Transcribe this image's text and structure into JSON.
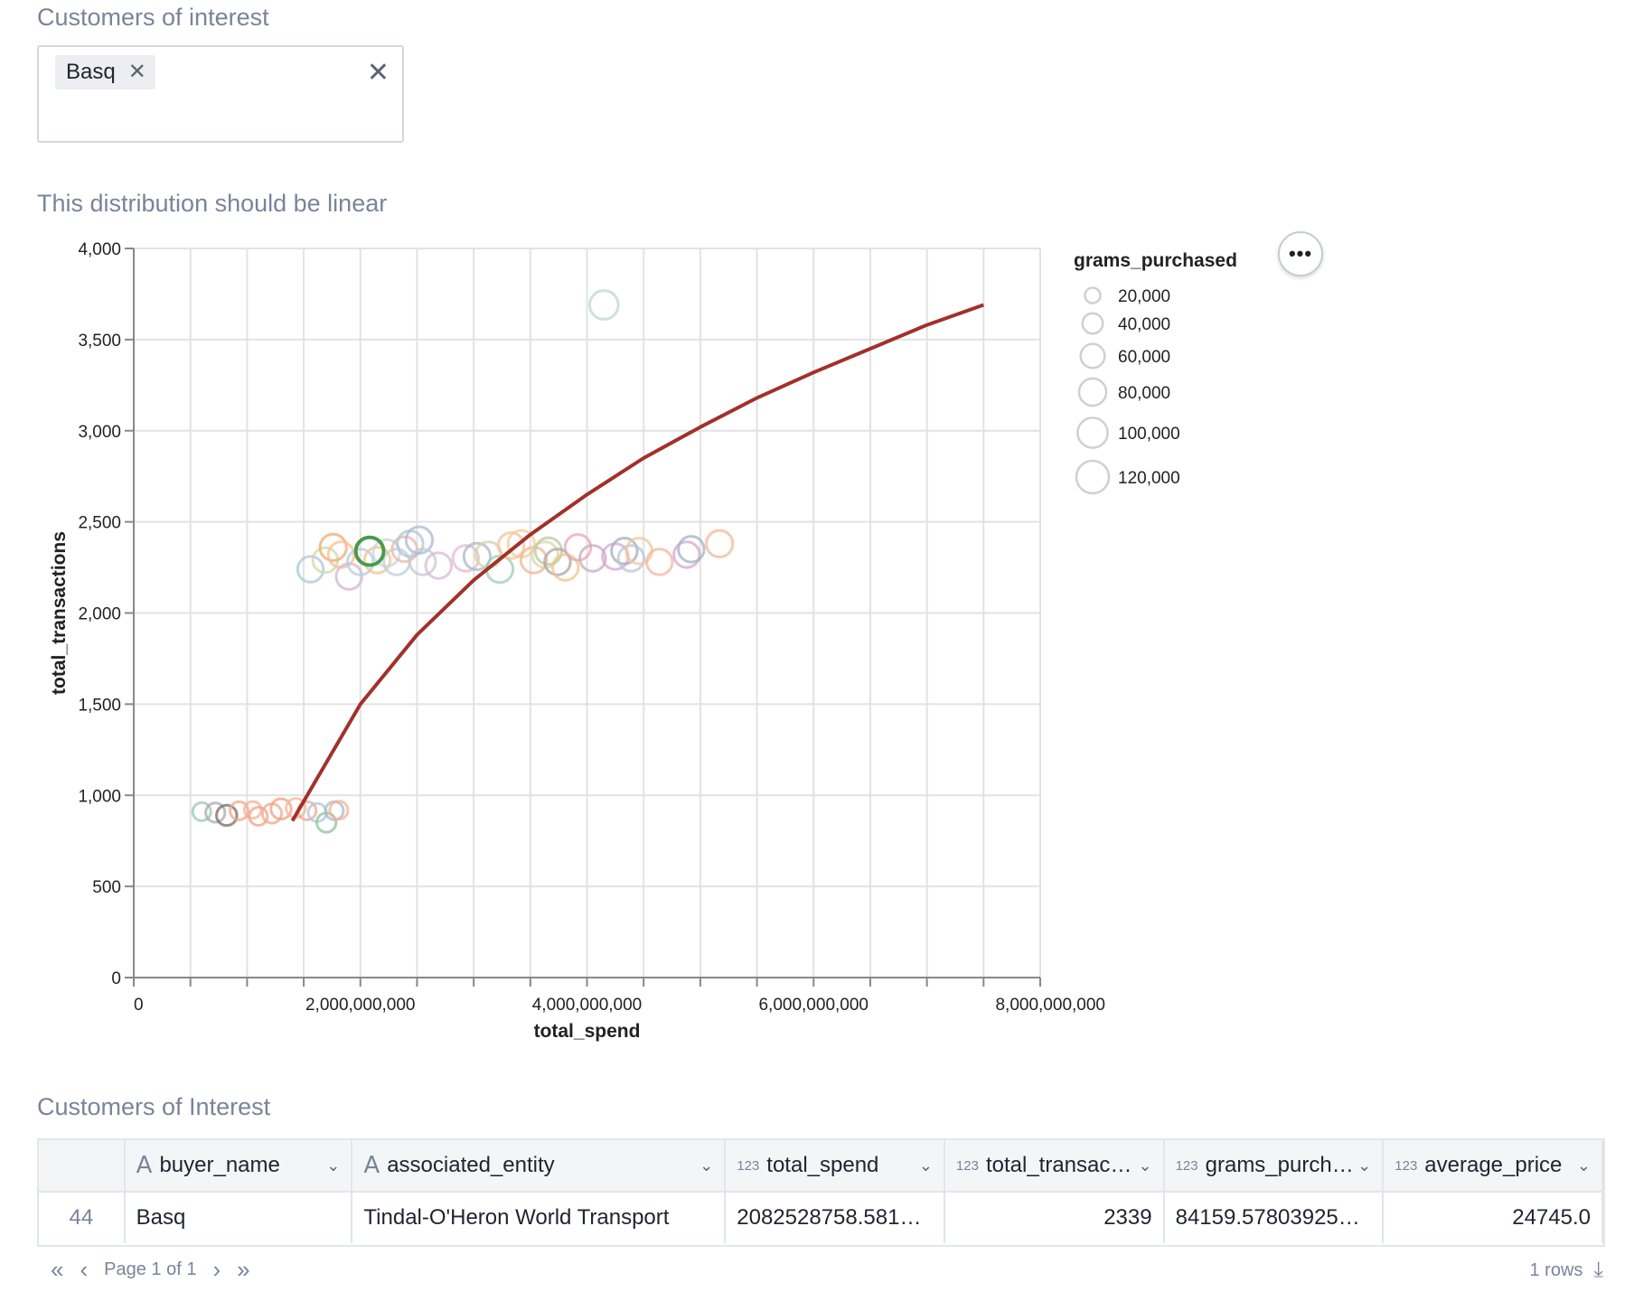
{
  "filter": {
    "title": "Customers of interest",
    "chips": [
      "Basq"
    ],
    "chip_remove_glyph": "✕",
    "clear_glyph": "✕"
  },
  "chart_section": {
    "title": "This distribution should be linear",
    "more_glyph": "•••"
  },
  "chart_data": {
    "type": "scatter",
    "title": "This distribution should be linear",
    "xlabel": "total_spend",
    "ylabel": "total_transactions",
    "xlim": [
      0,
      8000000000
    ],
    "ylim": [
      0,
      4000
    ],
    "xticks": [
      0,
      2000000000,
      4000000000,
      6000000000,
      8000000000
    ],
    "xtick_labels": [
      "0",
      "2,000,000,000",
      "4,000,000,000",
      "6,000,000,000",
      "8,000,000,000"
    ],
    "yticks": [
      0,
      500,
      1000,
      1500,
      2000,
      2500,
      3000,
      3500,
      4000
    ],
    "ytick_labels": [
      "0",
      "500",
      "1,000",
      "1,500",
      "2,000",
      "2,500",
      "3,000",
      "3,500",
      "4,000"
    ],
    "grid": true,
    "size_legend": {
      "title": "grams_purchased",
      "values": [
        20000,
        40000,
        60000,
        80000,
        100000,
        120000
      ],
      "labels": [
        "20,000",
        "40,000",
        "60,000",
        "80,000",
        "100,000",
        "120,000"
      ],
      "position": "top-right"
    },
    "trend_line": {
      "color": "#a3302a",
      "x": [
        1400000000,
        2000000000,
        2500000000,
        3000000000,
        3500000000,
        4000000000,
        4500000000,
        5000000000,
        5500000000,
        6000000000,
        6500000000,
        7000000000,
        7500000000
      ],
      "y": [
        860,
        1500,
        1880,
        2180,
        2430,
        2650,
        2850,
        3020,
        3180,
        3320,
        3450,
        3580,
        3690
      ]
    },
    "highlight": {
      "name": "Basq",
      "x": 2082528758,
      "y": 2339,
      "grams": 84160,
      "color": "#4a9a4a"
    },
    "points": [
      {
        "x": 600000000,
        "y": 910,
        "g": 30000,
        "c": "#9cc7b4"
      },
      {
        "x": 720000000,
        "y": 905,
        "g": 35000,
        "c": "#a9a9b6"
      },
      {
        "x": 820000000,
        "y": 890,
        "g": 40000,
        "c": "#7a6a60"
      },
      {
        "x": 930000000,
        "y": 915,
        "g": 30000,
        "c": "#f0a58a"
      },
      {
        "x": 1050000000,
        "y": 920,
        "g": 25000,
        "c": "#f4b09a"
      },
      {
        "x": 1100000000,
        "y": 885,
        "g": 30000,
        "c": "#f3a08a"
      },
      {
        "x": 1220000000,
        "y": 900,
        "g": 35000,
        "c": "#f0a890"
      },
      {
        "x": 1300000000,
        "y": 925,
        "g": 40000,
        "c": "#f2a080"
      },
      {
        "x": 1430000000,
        "y": 930,
        "g": 35000,
        "c": "#f6b49e"
      },
      {
        "x": 1530000000,
        "y": 915,
        "g": 30000,
        "c": "#f2a88c"
      },
      {
        "x": 1620000000,
        "y": 905,
        "g": 30000,
        "c": "#a9c9de"
      },
      {
        "x": 1700000000,
        "y": 850,
        "g": 35000,
        "c": "#8fc29a"
      },
      {
        "x": 1770000000,
        "y": 915,
        "g": 30000,
        "c": "#a4bcd0"
      },
      {
        "x": 1810000000,
        "y": 918,
        "g": 30000,
        "c": "#f4b092"
      },
      {
        "x": 1560000000,
        "y": 2240,
        "g": 70000,
        "c": "#a9c9d6"
      },
      {
        "x": 1690000000,
        "y": 2290,
        "g": 65000,
        "c": "#cfd9a9"
      },
      {
        "x": 1760000000,
        "y": 2360,
        "g": 75000,
        "c": "#f0a870"
      },
      {
        "x": 1830000000,
        "y": 2320,
        "g": 70000,
        "c": "#f4c18e"
      },
      {
        "x": 1900000000,
        "y": 2200,
        "g": 70000,
        "c": "#d7b3d3"
      },
      {
        "x": 2000000000,
        "y": 2280,
        "g": 70000,
        "c": "#b5cbe0"
      },
      {
        "x": 2150000000,
        "y": 2290,
        "g": 70000,
        "c": "#f2c48a"
      },
      {
        "x": 2230000000,
        "y": 2330,
        "g": 75000,
        "c": "#c9d6e0"
      },
      {
        "x": 2320000000,
        "y": 2280,
        "g": 70000,
        "c": "#bcd0d7"
      },
      {
        "x": 2390000000,
        "y": 2350,
        "g": 65000,
        "c": "#f2b6a4"
      },
      {
        "x": 2440000000,
        "y": 2380,
        "g": 70000,
        "c": "#b0c4d8"
      },
      {
        "x": 2520000000,
        "y": 2400,
        "g": 75000,
        "c": "#a6bcd3"
      },
      {
        "x": 2550000000,
        "y": 2280,
        "g": 70000,
        "c": "#c2c9d4"
      },
      {
        "x": 2690000000,
        "y": 2260,
        "g": 70000,
        "c": "#d5bcd6"
      },
      {
        "x": 2930000000,
        "y": 2300,
        "g": 70000,
        "c": "#e6b9cc"
      },
      {
        "x": 3030000000,
        "y": 2310,
        "g": 75000,
        "c": "#a8b8c9"
      },
      {
        "x": 3130000000,
        "y": 2320,
        "g": 70000,
        "c": "#d3d3a6"
      },
      {
        "x": 3230000000,
        "y": 2240,
        "g": 75000,
        "c": "#9fcdb0"
      },
      {
        "x": 3330000000,
        "y": 2370,
        "g": 70000,
        "c": "#f4c29a"
      },
      {
        "x": 3420000000,
        "y": 2380,
        "g": 75000,
        "c": "#f3cc92"
      },
      {
        "x": 3530000000,
        "y": 2290,
        "g": 70000,
        "c": "#f2b690"
      },
      {
        "x": 3630000000,
        "y": 2320,
        "g": 70000,
        "c": "#d9d7a4"
      },
      {
        "x": 3660000000,
        "y": 2340,
        "g": 75000,
        "c": "#b8c9a2"
      },
      {
        "x": 3740000000,
        "y": 2280,
        "g": 70000,
        "c": "#a7a7a7"
      },
      {
        "x": 3810000000,
        "y": 2250,
        "g": 70000,
        "c": "#f2c48a"
      },
      {
        "x": 3920000000,
        "y": 2360,
        "g": 70000,
        "c": "#e9a6b6"
      },
      {
        "x": 4050000000,
        "y": 2300,
        "g": 70000,
        "c": "#c9a9c4"
      },
      {
        "x": 4250000000,
        "y": 2310,
        "g": 70000,
        "c": "#d5a8d0"
      },
      {
        "x": 4330000000,
        "y": 2340,
        "g": 70000,
        "c": "#a9aabb"
      },
      {
        "x": 4390000000,
        "y": 2300,
        "g": 70000,
        "c": "#b4c8d6"
      },
      {
        "x": 4460000000,
        "y": 2340,
        "g": 70000,
        "c": "#f3c69a"
      },
      {
        "x": 4640000000,
        "y": 2280,
        "g": 70000,
        "c": "#f4b4a0"
      },
      {
        "x": 4880000000,
        "y": 2320,
        "g": 70000,
        "c": "#d2a9cc"
      },
      {
        "x": 4920000000,
        "y": 2350,
        "g": 70000,
        "c": "#a4b0c6"
      },
      {
        "x": 5170000000,
        "y": 2380,
        "g": 75000,
        "c": "#f4b896"
      },
      {
        "x": 4150000000,
        "y": 3690,
        "g": 90000,
        "c": "#bed8d0"
      }
    ]
  },
  "table": {
    "title": "Customers of Interest",
    "columns": [
      {
        "label": "",
        "type": "index"
      },
      {
        "label": "buyer_name",
        "type": "A"
      },
      {
        "label": "associated_entity",
        "type": "A"
      },
      {
        "label": "total_spend",
        "type": "123"
      },
      {
        "label": "total_transac…",
        "type": "123"
      },
      {
        "label": "grams_purch…",
        "type": "123"
      },
      {
        "label": "average_price",
        "type": "123"
      }
    ],
    "rows": [
      [
        "44",
        "Basq",
        "Tindal-O'Heron World Transport",
        "2082528758.581…",
        "2339",
        "84159.57803925…",
        "24745.0"
      ]
    ]
  },
  "pager": {
    "first": "«",
    "prev": "‹",
    "label": "Page 1 of 1",
    "next": "›",
    "last": "»",
    "rows": "1 rows",
    "download_icon": "⤓"
  }
}
